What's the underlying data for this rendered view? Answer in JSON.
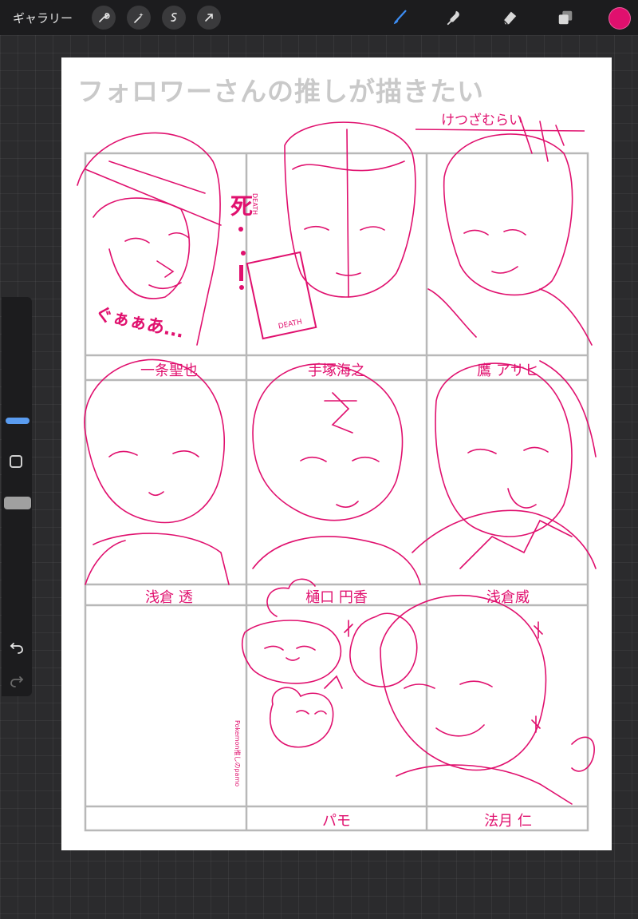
{
  "topbar": {
    "gallery_label": "ギャラリー",
    "left_tools": [
      {
        "icon": "wrench-icon"
      },
      {
        "icon": "magic-wand-icon"
      },
      {
        "icon": "selection-icon"
      },
      {
        "icon": "transform-arrow-icon"
      }
    ],
    "right_tools": [
      {
        "icon": "brush-icon"
      },
      {
        "icon": "smudge-icon"
      },
      {
        "icon": "eraser-icon"
      },
      {
        "icon": "layers-icon"
      }
    ],
    "current_color": "#e0106e"
  },
  "sidebar": {
    "undo_icon": "undo-icon",
    "redo_icon": "redo-icon",
    "modify_icon": "square-modify-icon"
  },
  "canvas": {
    "title": "フォロワーさんの推しが描きたい",
    "author": "けつざむらい",
    "sketch_color": "#e0106e",
    "grid_color": "#b8b8b8",
    "exclamation": "死",
    "exclamation_sub": "DEATH",
    "card_text": "DEATH",
    "sfx": "ぐぁぁあ...",
    "pamo_note": "Pokemon推しのpamo",
    "cells": [
      {
        "label": "一条聖也"
      },
      {
        "label": "手塚海之"
      },
      {
        "label": "鷹 アサヒ"
      },
      {
        "label": "浅倉 透"
      },
      {
        "label": "樋口 円香"
      },
      {
        "label": "浅倉威"
      },
      {
        "label": ""
      },
      {
        "label": "パモ"
      },
      {
        "label": "法月 仁"
      }
    ]
  }
}
